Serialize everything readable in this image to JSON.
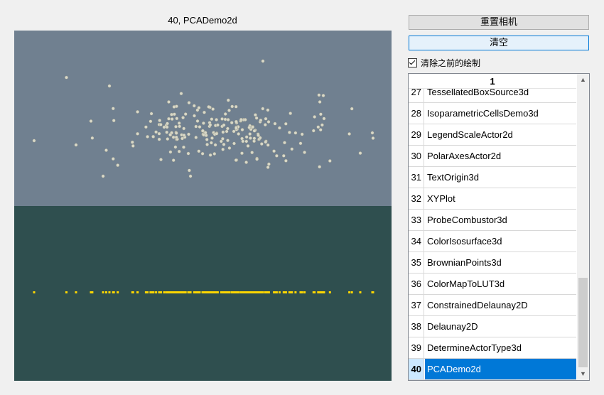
{
  "window": {
    "title": "40, PCADemo2d"
  },
  "controls": {
    "reset_camera_label": "重置相机",
    "clear_label": "清空",
    "clear_previous_label": "清除之前的绘制",
    "clear_previous_checked": true
  },
  "table": {
    "header": "1",
    "rows": [
      {
        "num": "27",
        "name": "TessellatedBoxSource3d"
      },
      {
        "num": "28",
        "name": "IsoparametricCellsDemo3d"
      },
      {
        "num": "29",
        "name": "LegendScaleActor2d"
      },
      {
        "num": "30",
        "name": "PolarAxesActor2d"
      },
      {
        "num": "31",
        "name": "TextOrigin3d"
      },
      {
        "num": "32",
        "name": "XYPlot"
      },
      {
        "num": "33",
        "name": "ProbeCombustor3d"
      },
      {
        "num": "34",
        "name": "ColorIsosurface3d"
      },
      {
        "num": "35",
        "name": "BrownianPoints3d"
      },
      {
        "num": "36",
        "name": "ColorMapToLUT3d"
      },
      {
        "num": "37",
        "name": "ConstrainedDelaunay2D"
      },
      {
        "num": "38",
        "name": "Delaunay2D"
      },
      {
        "num": "39",
        "name": "DetermineActorType3d"
      },
      {
        "num": "40",
        "name": "PCADemo2d"
      }
    ],
    "selected": "40"
  },
  "colors": {
    "top_viewport": "#708090",
    "bottom_viewport": "#2f4f4f",
    "points": "#d8d8c8",
    "projection": "#ffd700",
    "selection": "#0078d7"
  },
  "icons": {
    "scroll_up": "chevron-up-icon",
    "scroll_down": "chevron-down-icon",
    "checkbox": "checkmark-icon"
  }
}
